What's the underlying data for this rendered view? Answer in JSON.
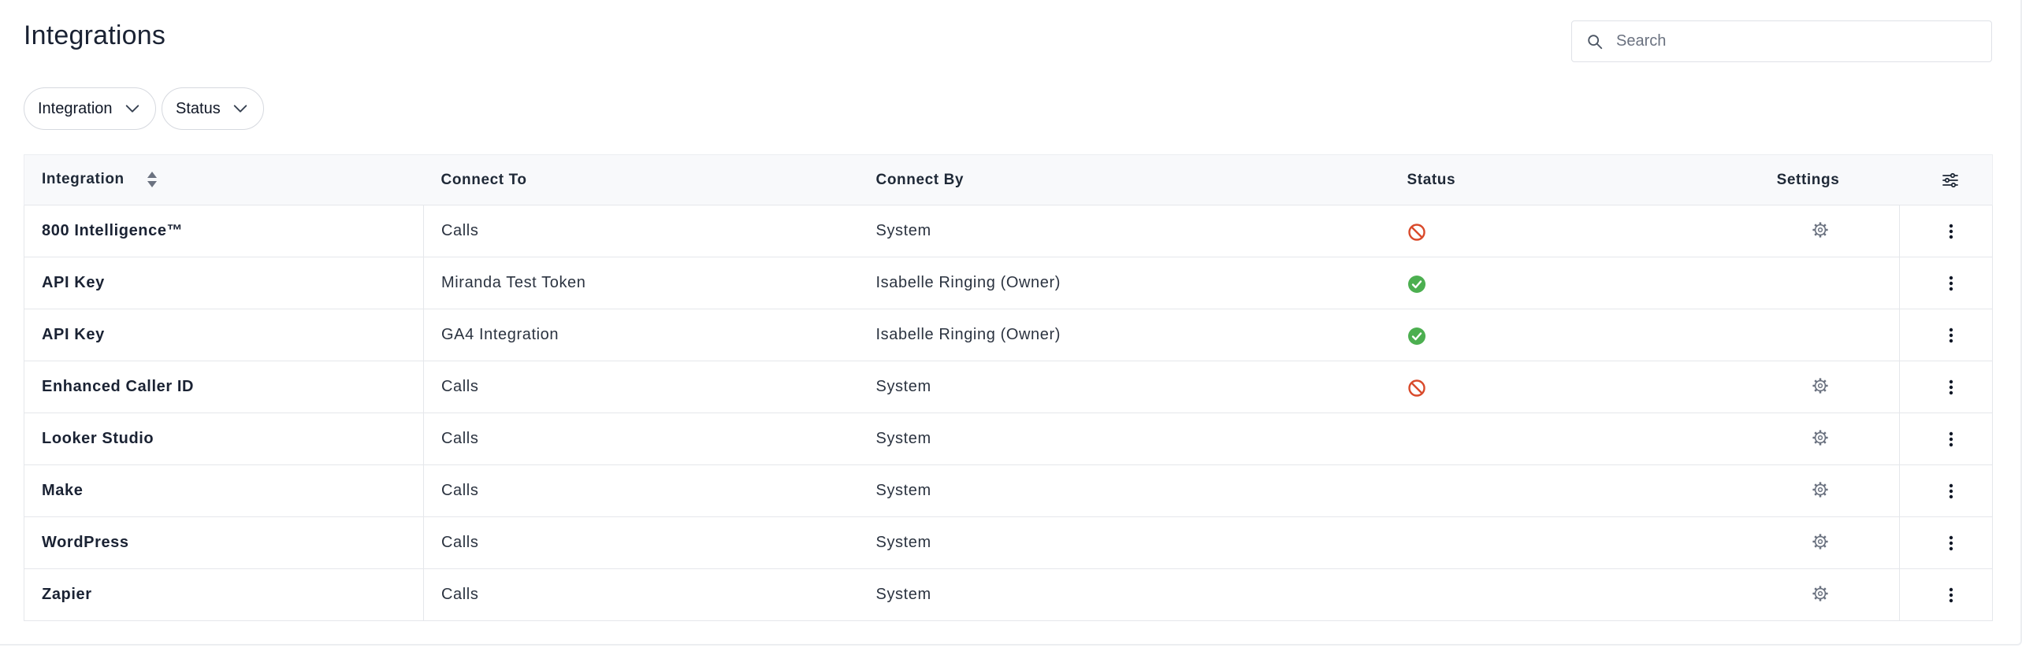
{
  "page": {
    "title": "Integrations"
  },
  "search": {
    "placeholder": "Search",
    "icon": "search-icon"
  },
  "filters": [
    {
      "label": "Integration",
      "icon": "chevron-down-icon"
    },
    {
      "label": "Status",
      "icon": "chevron-down-icon"
    }
  ],
  "table": {
    "headers": {
      "integration": "Integration",
      "connect_to": "Connect To",
      "connect_by": "Connect By",
      "status": "Status",
      "settings": "Settings"
    },
    "rows": [
      {
        "integration": "800 Intelligence™",
        "connect_to": "Calls",
        "connect_by": "System",
        "status": "disabled",
        "settings": true
      },
      {
        "integration": "API Key",
        "connect_to": "Miranda Test Token",
        "connect_by": "Isabelle Ringing (Owner)",
        "status": "active",
        "settings": false
      },
      {
        "integration": "API Key",
        "connect_to": "GA4 Integration",
        "connect_by": "Isabelle Ringing (Owner)",
        "status": "active",
        "settings": false
      },
      {
        "integration": "Enhanced Caller ID",
        "connect_to": "Calls",
        "connect_by": "System",
        "status": "disabled",
        "settings": true
      },
      {
        "integration": "Looker Studio",
        "connect_to": "Calls",
        "connect_by": "System",
        "status": "none",
        "settings": true
      },
      {
        "integration": "Make",
        "connect_to": "Calls",
        "connect_by": "System",
        "status": "none",
        "settings": true
      },
      {
        "integration": "WordPress",
        "connect_to": "Calls",
        "connect_by": "System",
        "status": "none",
        "settings": true
      },
      {
        "integration": "Zapier",
        "connect_to": "Calls",
        "connect_by": "System",
        "status": "none",
        "settings": true
      }
    ]
  },
  "colors": {
    "status_active": "#4caf50",
    "status_disabled": "#d94a2b",
    "header_bg": "#f8f9fb",
    "border": "#e5e7eb"
  }
}
